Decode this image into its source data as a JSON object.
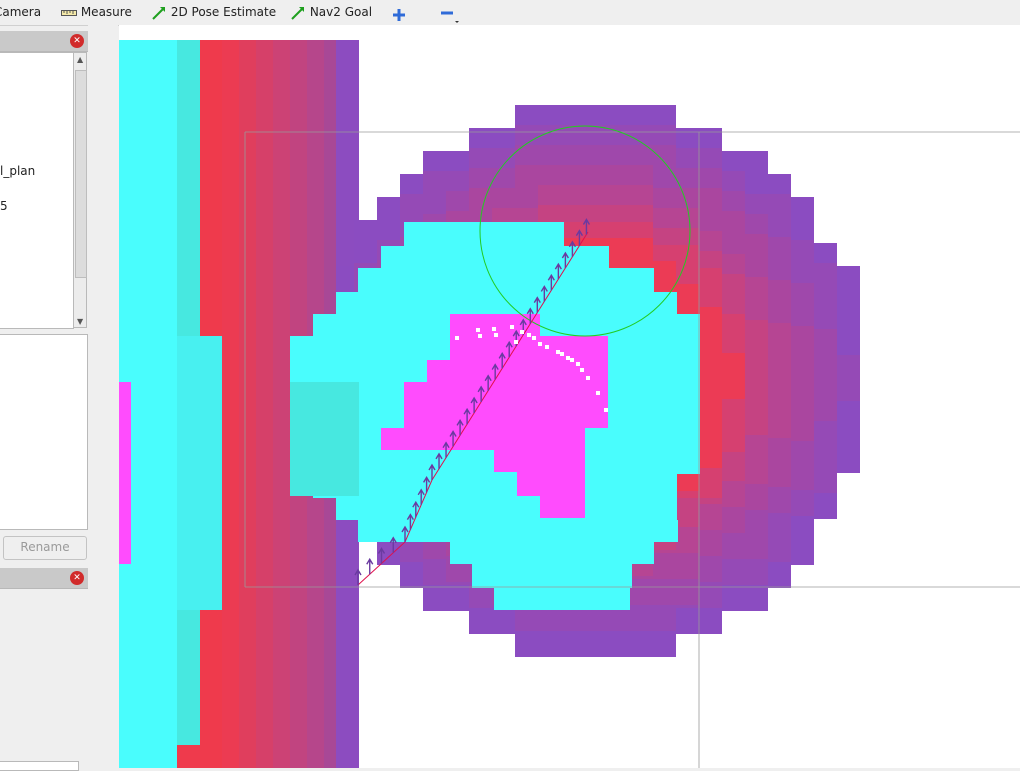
{
  "toolbar": {
    "camera_label": "Camera",
    "measure_label": "Measure",
    "pose_estimate_label": "2D Pose Estimate",
    "nav2_goal_label": "Nav2 Goal"
  },
  "properties": {
    "rows": [
      "l_plan",
      "5"
    ]
  },
  "rename_label": "Rename",
  "colors": {
    "costmap_cyan": "#49fdfd",
    "costmap_magenta": "#ff4cfd",
    "costmap_red": "#ef3a4c",
    "costmap_purple": "#8c4cc0",
    "footprint": "#22cc22",
    "path": "#e0104c"
  }
}
